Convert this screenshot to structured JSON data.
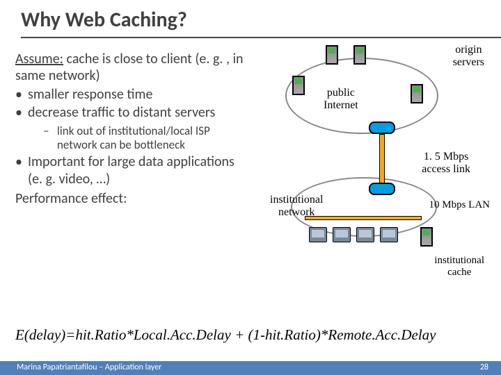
{
  "title": "Why Web Caching?",
  "text": {
    "assume_u": "Assume:",
    "assume_rest": " cache is close to client (e. g. , in same network)",
    "b1": "smaller response time",
    "b2": "decrease traffic to distant servers",
    "sub1": "link out of institutional/local ISP network can be bottleneck",
    "b3": "Important for large data applications (e. g. video, …)",
    "perf": "Performance effect:"
  },
  "labels": {
    "origin": "origin\nservers",
    "public": "public\nInternet",
    "access": "1. 5 Mbps\naccess link",
    "lan": "10 Mbps LAN",
    "inst": "institutional\nnetwork",
    "cache": "institutional\ncache"
  },
  "formula": "E(delay)=hit.Ratio*Local.Acc.Delay + (1-hit.Ratio)*Remote.Acc.Delay",
  "footer": {
    "author": "Marina Papatriantafilou – Application layer",
    "page": "28"
  }
}
